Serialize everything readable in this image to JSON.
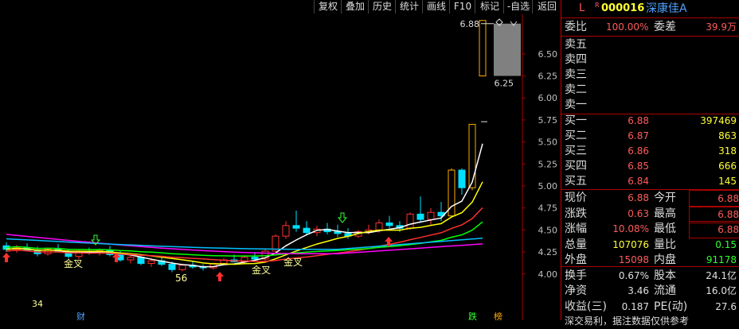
{
  "toolbar": {
    "items": [
      "复权",
      "叠加",
      "历史",
      "统计",
      "画线",
      "F10",
      "标记",
      "-自选",
      "返回"
    ]
  },
  "header": {
    "level_flag": "L",
    "superscript": "R",
    "code": "000016",
    "name": "深康佳A"
  },
  "order_book_summary": {
    "wei_bi_label": "委比",
    "wei_bi_value": "100.00%",
    "wei_cha_label": "委差",
    "wei_cha_value": "39.9万"
  },
  "asks": [
    {
      "label": "卖五",
      "price": "",
      "vol": ""
    },
    {
      "label": "卖四",
      "price": "",
      "vol": ""
    },
    {
      "label": "卖三",
      "price": "",
      "vol": ""
    },
    {
      "label": "卖二",
      "price": "",
      "vol": ""
    },
    {
      "label": "卖一",
      "price": "",
      "vol": ""
    }
  ],
  "bids": [
    {
      "label": "买一",
      "price": "6.88",
      "vol": "397469"
    },
    {
      "label": "买二",
      "price": "6.87",
      "vol": "863"
    },
    {
      "label": "买三",
      "price": "6.86",
      "vol": "318"
    },
    {
      "label": "买四",
      "price": "6.85",
      "vol": "666"
    },
    {
      "label": "买五",
      "price": "6.84",
      "vol": "145"
    }
  ],
  "quote": [
    {
      "l1": "现价",
      "v1": "6.88",
      "l2": "今开",
      "v2": "6.88"
    },
    {
      "l1": "涨跌",
      "v1": "0.63",
      "l2": "最高",
      "v2": "6.88"
    },
    {
      "l1": "涨幅",
      "v1": "10.08%",
      "l2": "最低",
      "v2": "6.88"
    },
    {
      "l1": "总量",
      "v1": "107076",
      "l2": "量比",
      "v2": "0.15"
    },
    {
      "l1": "外盘",
      "v1": "15098",
      "l2": "内盘",
      "v2": "91178"
    },
    {
      "l1": "换手",
      "v1": "0.67%",
      "l2": "股本",
      "v2": "24.1亿"
    },
    {
      "l1": "净资",
      "v1": "3.46",
      "l2": "流通",
      "v2": "16.0亿"
    },
    {
      "l1": "收益(三)",
      "v1": "0.187",
      "l2": "PE(动)",
      "v2": "27.6"
    }
  ],
  "footer_text": "深交易利，据注数据仅供参考",
  "chart_labels": {
    "high_marker": "6.88",
    "low_marker": "6.25",
    "low_marker2": "56",
    "left_label": "34",
    "gold_cross_1": "金叉",
    "gold_cross_2": "金叉",
    "gold_cross_3": "金叉",
    "cai": "财",
    "die": "跌",
    "bang": "榜"
  },
  "chart_data": {
    "type": "candlestick",
    "y_ticks": [
      "6.50",
      "6.25",
      "6.00",
      "5.75",
      "5.50",
      "5.25",
      "5.00",
      "4.75",
      "4.50",
      "4.25",
      "4.00"
    ],
    "ylim": [
      3.7,
      6.95
    ],
    "colors": {
      "up": "#ff3030",
      "down": "#00e0ff",
      "ma5": "#ffffff",
      "ma10": "#ffff00",
      "ma20": "#ff3030",
      "ma60": "#ff00ff",
      "ma30": "#00ff00",
      "ma120": "#00c0ff",
      "limit": "#ffaa00"
    },
    "candles": [
      {
        "o": 4.32,
        "h": 4.36,
        "l": 4.25,
        "c": 4.28
      },
      {
        "o": 4.28,
        "h": 4.33,
        "l": 4.24,
        "c": 4.3
      },
      {
        "o": 4.3,
        "h": 4.35,
        "l": 4.26,
        "c": 4.27
      },
      {
        "o": 4.27,
        "h": 4.31,
        "l": 4.2,
        "c": 4.23
      },
      {
        "o": 4.23,
        "h": 4.3,
        "l": 4.21,
        "c": 4.28
      },
      {
        "o": 4.28,
        "h": 4.34,
        "l": 4.25,
        "c": 4.26
      },
      {
        "o": 4.26,
        "h": 4.28,
        "l": 4.18,
        "c": 4.2
      },
      {
        "o": 4.2,
        "h": 4.27,
        "l": 4.17,
        "c": 4.25
      },
      {
        "o": 4.25,
        "h": 4.3,
        "l": 4.22,
        "c": 4.24
      },
      {
        "o": 4.24,
        "h": 4.29,
        "l": 4.21,
        "c": 4.27
      },
      {
        "o": 4.27,
        "h": 4.32,
        "l": 4.2,
        "c": 4.22
      },
      {
        "o": 4.22,
        "h": 4.26,
        "l": 4.14,
        "c": 4.16
      },
      {
        "o": 4.16,
        "h": 4.22,
        "l": 4.12,
        "c": 4.19
      },
      {
        "o": 4.19,
        "h": 4.21,
        "l": 4.1,
        "c": 4.12
      },
      {
        "o": 4.12,
        "h": 4.18,
        "l": 4.08,
        "c": 4.15
      },
      {
        "o": 4.15,
        "h": 4.19,
        "l": 4.09,
        "c": 4.11
      },
      {
        "o": 4.11,
        "h": 4.14,
        "l": 4.02,
        "c": 4.05
      },
      {
        "o": 4.05,
        "h": 4.12,
        "l": 4.03,
        "c": 4.1
      },
      {
        "o": 4.1,
        "h": 4.15,
        "l": 4.06,
        "c": 4.08
      },
      {
        "o": 4.08,
        "h": 4.11,
        "l": 4.04,
        "c": 4.07
      },
      {
        "o": 4.07,
        "h": 4.13,
        "l": 4.05,
        "c": 4.12
      },
      {
        "o": 4.12,
        "h": 4.18,
        "l": 4.1,
        "c": 4.16
      },
      {
        "o": 4.16,
        "h": 4.22,
        "l": 4.13,
        "c": 4.14
      },
      {
        "o": 4.14,
        "h": 4.2,
        "l": 4.11,
        "c": 4.19
      },
      {
        "o": 4.19,
        "h": 4.25,
        "l": 4.16,
        "c": 4.17
      },
      {
        "o": 4.17,
        "h": 4.28,
        "l": 4.15,
        "c": 4.26
      },
      {
        "o": 4.26,
        "h": 4.45,
        "l": 4.25,
        "c": 4.43
      },
      {
        "o": 4.43,
        "h": 4.6,
        "l": 4.4,
        "c": 4.55
      },
      {
        "o": 4.55,
        "h": 4.72,
        "l": 4.48,
        "c": 4.52
      },
      {
        "o": 4.52,
        "h": 4.6,
        "l": 4.44,
        "c": 4.47
      },
      {
        "o": 4.47,
        "h": 4.55,
        "l": 4.43,
        "c": 4.51
      },
      {
        "o": 4.51,
        "h": 4.58,
        "l": 4.45,
        "c": 4.48
      },
      {
        "o": 4.48,
        "h": 4.56,
        "l": 4.42,
        "c": 4.46
      },
      {
        "o": 4.46,
        "h": 4.52,
        "l": 4.4,
        "c": 4.43
      },
      {
        "o": 4.43,
        "h": 4.5,
        "l": 4.41,
        "c": 4.48
      },
      {
        "o": 4.48,
        "h": 4.56,
        "l": 4.45,
        "c": 4.5
      },
      {
        "o": 4.5,
        "h": 4.62,
        "l": 4.47,
        "c": 4.58
      },
      {
        "o": 4.58,
        "h": 4.66,
        "l": 4.52,
        "c": 4.55
      },
      {
        "o": 4.55,
        "h": 4.6,
        "l": 4.48,
        "c": 4.52
      },
      {
        "o": 4.52,
        "h": 4.7,
        "l": 4.5,
        "c": 4.68
      },
      {
        "o": 4.68,
        "h": 4.88,
        "l": 4.58,
        "c": 4.62
      },
      {
        "o": 4.62,
        "h": 4.75,
        "l": 4.55,
        "c": 4.7
      },
      {
        "o": 4.7,
        "h": 4.82,
        "l": 4.6,
        "c": 4.66
      },
      {
        "o": 4.66,
        "h": 5.2,
        "l": 4.64,
        "c": 5.18
      },
      {
        "o": 5.18,
        "h": 5.2,
        "l": 4.9,
        "c": 4.98
      },
      {
        "o": 4.98,
        "h": 5.7,
        "l": 4.95,
        "c": 5.7
      },
      {
        "o": 6.25,
        "h": 6.88,
        "l": 6.25,
        "c": 6.88
      }
    ]
  }
}
